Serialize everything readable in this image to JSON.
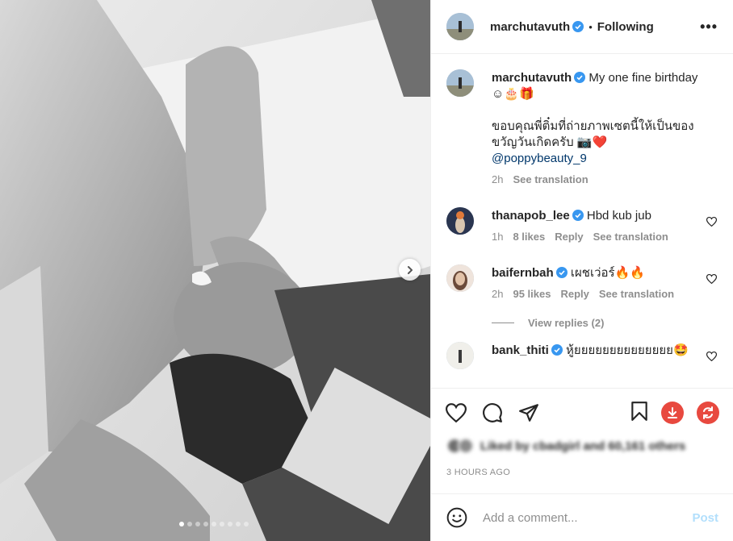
{
  "post": {
    "author": "marchutavuth",
    "follow_status": "Following",
    "separator": "•",
    "more_label": "•••",
    "caption": {
      "line1": "My one fine birthday",
      "line2": "☺🎂🎁",
      "line3": "ขอบคุณพี่ติ๋มที่ถ่ายภาพเซตนี้ให้เป็นของ",
      "line4": "ขวัญวันเกิดครับ 📷❤️",
      "mention": "@poppybeauty_9",
      "time": "2h",
      "see_translation": "See translation"
    },
    "carousel": {
      "count": 9,
      "active_index": 0
    }
  },
  "comments": [
    {
      "username": "thanapob_lee",
      "text": "Hbd kub jub",
      "time": "1h",
      "likes": "8 likes",
      "reply": "Reply",
      "see_translation": "See translation"
    },
    {
      "username": "baifernbah",
      "text": "เผชเว่อร์🔥🔥",
      "time": "2h",
      "likes": "95 likes",
      "reply": "Reply",
      "see_translation": "See translation",
      "view_replies": "View replies (2)"
    },
    {
      "username": "bank_thiti",
      "text": "หู้ยยยยยยยยยยยยยย🤩"
    }
  ],
  "likes_summary": "Liked by cbadgirl and 60,161 others",
  "timestamp": "3 HOURS AGO",
  "composer": {
    "placeholder": "Add a comment...",
    "post_label": "Post"
  },
  "colors": {
    "verified": "#3897f0",
    "download": "#e8493f",
    "repost": "#e8493f",
    "link": "#00376b",
    "post_disabled": "#b2dffc"
  },
  "icons": [
    "heart-icon",
    "comment-icon",
    "share-icon",
    "bookmark-icon",
    "download-icon",
    "repost-icon",
    "emoji-icon",
    "chevron-right-icon",
    "more-icon",
    "verified-icon"
  ]
}
